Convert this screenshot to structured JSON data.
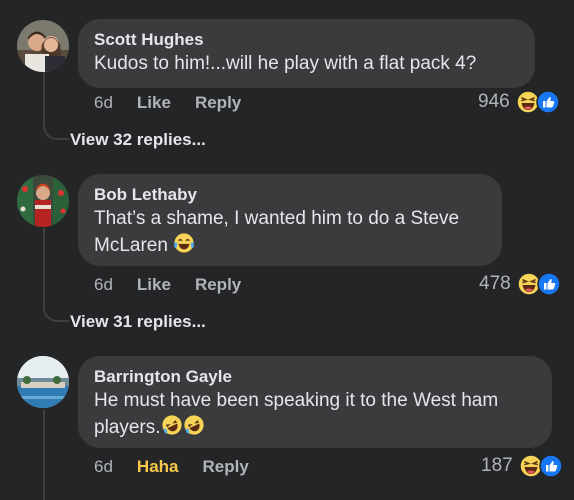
{
  "comments": [
    {
      "author": "Scott Hughes",
      "text": "Kudos to  him!...will  he play with a flat pack 4?",
      "time": "6d",
      "like_label": "Like",
      "reply_label": "Reply",
      "reaction_count": "946",
      "view_replies": "View 32 replies..."
    },
    {
      "author": "Bob Lethaby",
      "text_line1": "That’s a shame, I wanted him to do a Steve",
      "text_line2": "McLaren",
      "time": "6d",
      "like_label": "Like",
      "reply_label": "Reply",
      "reaction_count": "478",
      "view_replies": "View 31 replies..."
    },
    {
      "author": "Barrington Gayle",
      "text_line1": "He must have been  speaking it to the West ham",
      "text_line2": "players.",
      "time": "6d",
      "like_label": "Haha",
      "reply_label": "Reply",
      "reaction_count": "187"
    }
  ],
  "colors": {
    "background": "#242526",
    "bubble": "#3a3b3c",
    "haha_active": "#f7c84a",
    "like_blue": "#1877f2",
    "muted_text": "#b0b3b8"
  },
  "icons": {
    "haha": "haha-emoji-icon",
    "like": "like-thumb-icon",
    "tears_of_joy": "face-with-tears-of-joy-icon",
    "rofl": "rolling-on-floor-laughing-icon"
  }
}
